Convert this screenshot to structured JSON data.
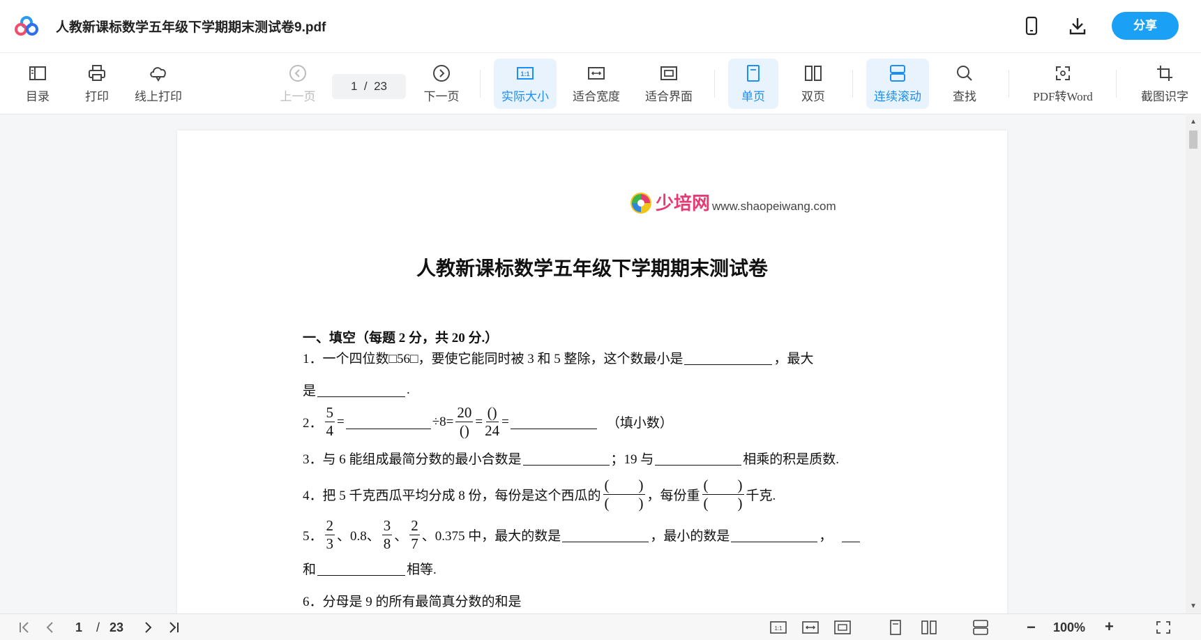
{
  "app": {
    "doc_title": "人教新课标数学五年级下学期期末测试卷9.pdf",
    "share_label": "分享",
    "icons": [
      "baidu-netdisk-logo-icon",
      "mobile-icon",
      "download-icon"
    ]
  },
  "toolbar": {
    "toc": "目录",
    "print": "打印",
    "online_print": "线上打印",
    "prev_page": "上一页",
    "page_current": "1",
    "page_sep": "/",
    "page_total": "23",
    "next_page": "下一页",
    "actual_size": "实际大小",
    "fit_width": "适合宽度",
    "fit_page": "适合界面",
    "single_page": "单页",
    "double_page": "双页",
    "continuous_scroll": "连续滚动",
    "find": "查找",
    "pdf_to_word": "PDF转Word",
    "screenshot_ocr": "截图识字",
    "accent_color": "#1a8ff5"
  },
  "document": {
    "brand_name": "少培网",
    "brand_url": "www.shaopeiwang.com",
    "title": "人教新课标数学五年级下学期期末测试卷",
    "section1": "一、填空（每题 2 分，共 20 分.）",
    "q1a": "1．一个四位数□56□，要使它能同时被 3 和 5 整除，这个数最小是",
    "q1b": "，最大",
    "q1c": "是",
    "q1d": ".",
    "q2_prefix": "2．",
    "q2_f1_num": "5",
    "q2_f1_den": "4",
    "q2_eq1": "=",
    "q2_div": "÷8=",
    "q2_f2_num": "20",
    "q2_f2_den": "()",
    "q2_eq2": "=",
    "q2_f3_num": "()",
    "q2_f3_den": "24",
    "q2_eq3": "=",
    "q2_suffix": "（填小数）",
    "q3a": "3．与 6 能组成最简分数的最小合数是",
    "q3b": "；19 与",
    "q3c": "相乘的积是质数.",
    "q4a": "4．把 5 千克西瓜平均分成 8 份，每份是这个西瓜的",
    "q4_paren": "(　　)",
    "q4b": "，每份重",
    "q4c": "千克.",
    "q5_prefix": "5．",
    "q5_f1_num": "2",
    "q5_f1_den": "3",
    "q5_mid1": "、0.8、",
    "q5_f2_num": "3",
    "q5_f2_den": "8",
    "q5_mid2": "、",
    "q5_f3_num": "2",
    "q5_f3_den": "7",
    "q5_b": "、0.375 中，最大的数是",
    "q5_c": "，最小的数是",
    "q5_d": "，",
    "q5_e": "和",
    "q5_f": "相等.",
    "q6_partial": "6．分母是 9 的所有最简真分数的和是"
  },
  "statusbar": {
    "page_current": "1",
    "page_sep": "/",
    "page_total": "23",
    "zoom": "100%",
    "zoom_out": "−",
    "zoom_in": "+"
  }
}
